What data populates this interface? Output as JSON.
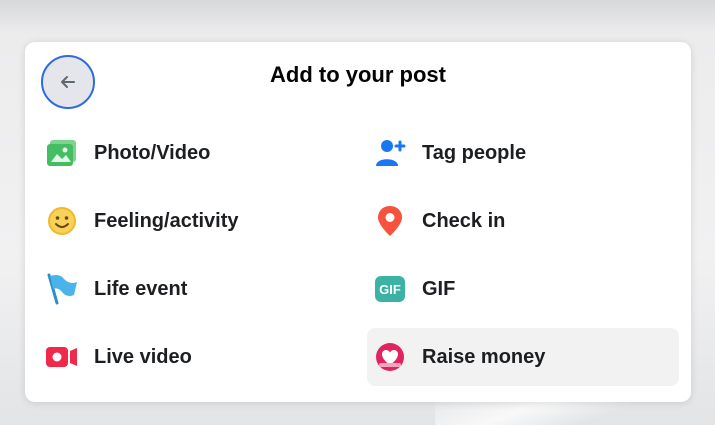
{
  "dialog": {
    "title": "Add to your post",
    "back_button_icon": "left-arrow-icon"
  },
  "options": [
    {
      "label": "Photo/Video",
      "icon": "photo-video-icon",
      "color": "#45bd62"
    },
    {
      "label": "Tag people",
      "icon": "tag-people-icon",
      "color": "#1877f2"
    },
    {
      "label": "Feeling/activity",
      "icon": "feeling-icon",
      "color": "#f7b928"
    },
    {
      "label": "Check in",
      "icon": "location-pin-icon",
      "color": "#f5533d"
    },
    {
      "label": "Life event",
      "icon": "flag-icon",
      "color": "#3ea7e0"
    },
    {
      "label": "GIF",
      "icon": "gif-icon",
      "color": "#3bb2a4"
    },
    {
      "label": "Live video",
      "icon": "live-video-icon",
      "color": "#f02849"
    },
    {
      "label": "Raise money",
      "icon": "raise-money-icon",
      "color": "#e0245e"
    }
  ],
  "gif_icon_text": "GIF"
}
